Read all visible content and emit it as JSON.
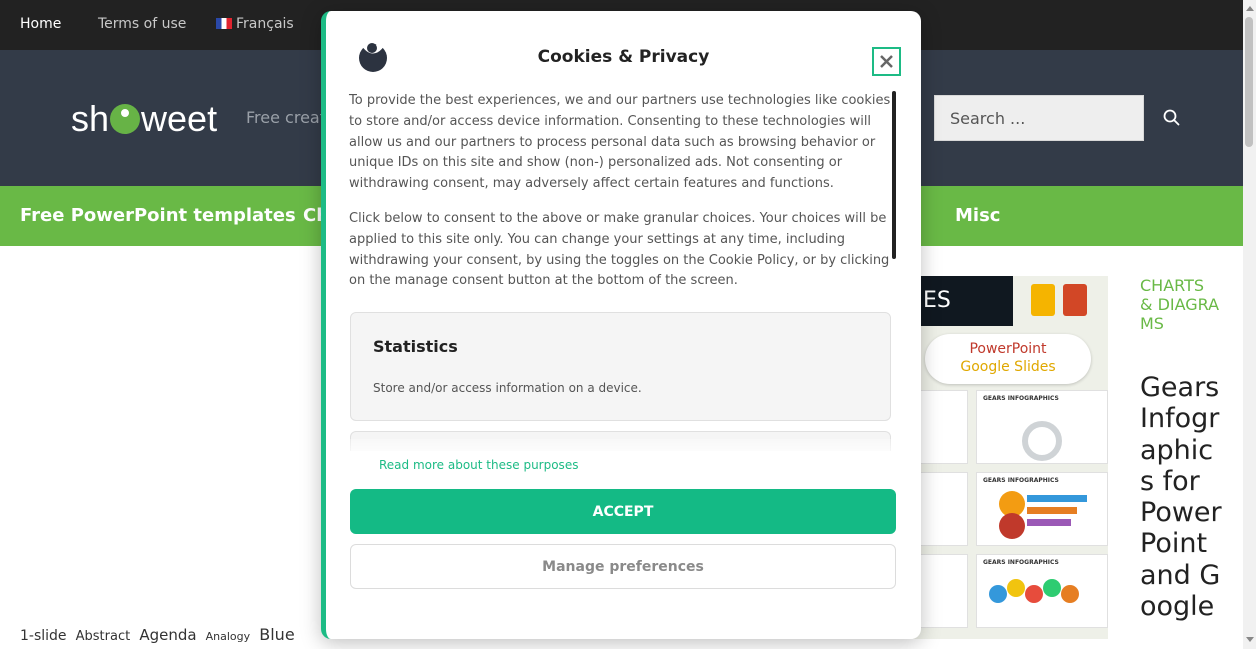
{
  "topnav": {
    "home": "Home",
    "terms": "Terms of use",
    "language": "Français"
  },
  "header": {
    "logo_pre": "sh",
    "logo_post": "weet",
    "tagline": "Free creat",
    "search_placeholder": "Search ..."
  },
  "mainnav": {
    "item1": "Free PowerPoint templates",
    "item2": "Ch",
    "item3": "Misc"
  },
  "post": {
    "thumb_label": "ES",
    "thumb_pill_line1": "PowerPoint",
    "thumb_pill_line2": "Google Slides",
    "slide_heading": "GEARS INFOGRAPHICS",
    "category": "CHARTS & DIAGRAMS",
    "title": "Gears Infographics for PowerPoint and Google"
  },
  "tags": [
    {
      "label": "1-slide"
    },
    {
      "label": "Abstract"
    },
    {
      "label": "Agenda"
    },
    {
      "label": "Analogy"
    },
    {
      "label": "Blue"
    }
  ],
  "modal": {
    "title": "Cookies & Privacy",
    "paragraph1": "To provide the best experiences, we and our partners use technologies like cookies to store and/or access device information. Consenting to these technologies will allow us and our partners to process personal data such as browsing behavior or unique IDs on this site and show (non-) personalized ads. Not consenting or withdrawing consent, may adversely affect certain features and functions.",
    "paragraph2": "Click below to consent to the above or make granular choices. Your choices will be applied to this site only. You can change your settings at any time, including withdrawing your consent, by using the toggles on the Cookie Policy, or by clicking on the manage consent button at the bottom of the screen.",
    "card_title": "Statistics",
    "card_desc": "Store and/or access information on a device.",
    "read_more": "Read more about these purposes",
    "accept": "ACCEPT",
    "manage": "Manage preferences"
  },
  "colors": {
    "green_nav": "#69b946",
    "header_bg": "#333b48",
    "accent": "#1dbb85"
  }
}
